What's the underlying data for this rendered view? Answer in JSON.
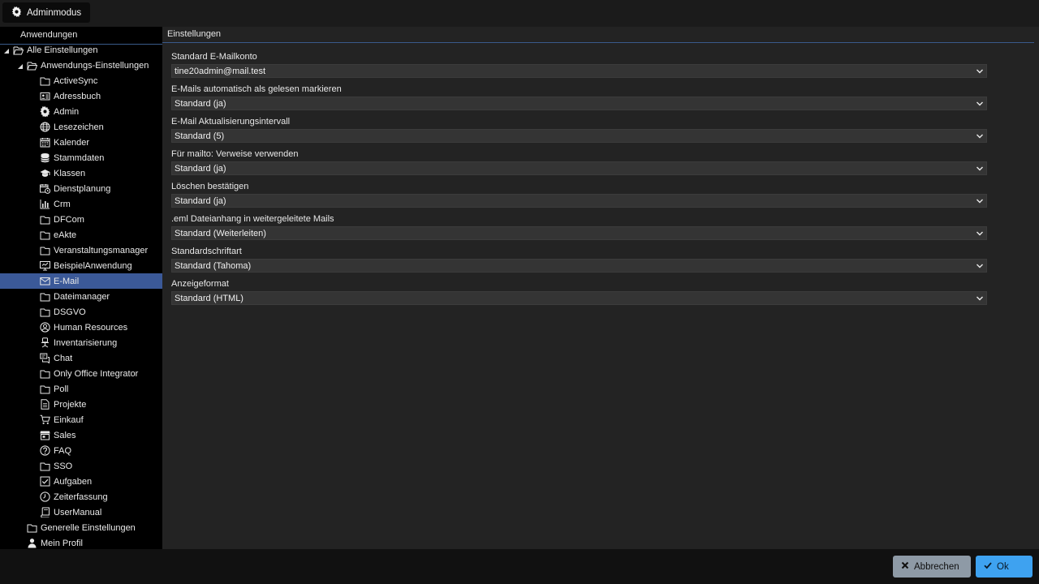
{
  "topbar": {
    "admin_label": "Adminmodus"
  },
  "sidebar": {
    "header": "Anwendungen",
    "tree": [
      {
        "label": "Alle Einstellungen",
        "icon": "folder-open-icon",
        "level": 0,
        "expanded": true
      },
      {
        "label": "Anwendungs-Einstellungen",
        "icon": "folder-open-icon",
        "level": 1,
        "expanded": true
      },
      {
        "label": "ActiveSync",
        "icon": "folder-icon",
        "level": 2
      },
      {
        "label": "Adressbuch",
        "icon": "address-card-icon",
        "level": 2
      },
      {
        "label": "Admin",
        "icon": "gear-icon",
        "level": 2
      },
      {
        "label": "Lesezeichen",
        "icon": "globe-icon",
        "level": 2
      },
      {
        "label": "Kalender",
        "icon": "calendar-icon",
        "level": 2
      },
      {
        "label": "Stammdaten",
        "icon": "database-icon",
        "level": 2
      },
      {
        "label": "Klassen",
        "icon": "graduation-cap-icon",
        "level": 2
      },
      {
        "label": "Dienstplanung",
        "icon": "calendar-clock-icon",
        "level": 2
      },
      {
        "label": "Crm",
        "icon": "bar-chart-icon",
        "level": 2
      },
      {
        "label": "DFCom",
        "icon": "folder-icon",
        "level": 2
      },
      {
        "label": "eAkte",
        "icon": "folder-icon",
        "level": 2
      },
      {
        "label": "Veranstaltungsmanager",
        "icon": "folder-icon",
        "level": 2
      },
      {
        "label": "BeispielAnwendung",
        "icon": "monitor-icon",
        "level": 2
      },
      {
        "label": "E-Mail",
        "icon": "envelope-icon",
        "level": 2,
        "selected": true
      },
      {
        "label": "Dateimanager",
        "icon": "folder-icon",
        "level": 2
      },
      {
        "label": "DSGVO",
        "icon": "folder-icon",
        "level": 2
      },
      {
        "label": "Human Resources",
        "icon": "user-circle-icon",
        "level": 2
      },
      {
        "label": "Inventarisierung",
        "icon": "chair-icon",
        "level": 2
      },
      {
        "label": "Chat",
        "icon": "chat-icon",
        "level": 2
      },
      {
        "label": "Only Office Integrator",
        "icon": "folder-icon",
        "level": 2
      },
      {
        "label": "Poll",
        "icon": "folder-icon",
        "level": 2
      },
      {
        "label": "Projekte",
        "icon": "document-icon",
        "level": 2
      },
      {
        "label": "Einkauf",
        "icon": "cart-icon",
        "level": 2
      },
      {
        "label": "Sales",
        "icon": "store-icon",
        "level": 2
      },
      {
        "label": "FAQ",
        "icon": "question-circle-icon",
        "level": 2
      },
      {
        "label": "SSO",
        "icon": "folder-icon",
        "level": 2
      },
      {
        "label": "Aufgaben",
        "icon": "checkbox-icon",
        "level": 2
      },
      {
        "label": "Zeiterfassung",
        "icon": "clock-icon",
        "level": 2
      },
      {
        "label": "UserManual",
        "icon": "book-icon",
        "level": 2
      },
      {
        "label": "Generelle Einstellungen",
        "icon": "folder-icon",
        "level": 1
      },
      {
        "label": "Mein Profil",
        "icon": "user-icon",
        "level": 1
      }
    ]
  },
  "main": {
    "header": "Einstellungen",
    "fields": [
      {
        "label": "Standard E-Mailkonto",
        "value": "tine20admin@mail.test"
      },
      {
        "label": "E-Mails automatisch als gelesen markieren",
        "value": "Standard (ja)"
      },
      {
        "label": "E-Mail Aktualisierungsintervall",
        "value": "Standard (5)"
      },
      {
        "label": "Für mailto: Verweise verwenden",
        "value": "Standard (ja)"
      },
      {
        "label": "Löschen bestätigen",
        "value": "Standard (ja)"
      },
      {
        "label": ".eml Dateianhang in weitergeleitete Mails",
        "value": "Standard (Weiterleiten)"
      },
      {
        "label": "Standardschriftart",
        "value": "Standard (Tahoma)"
      },
      {
        "label": "Anzeigeformat",
        "value": "Standard (HTML)"
      }
    ]
  },
  "footer": {
    "cancel_label": "Abbrechen",
    "ok_label": "Ok"
  },
  "colors": {
    "selected": "#3b5998",
    "ok_button": "#3ea2f0",
    "cancel_button": "#8e9aa6"
  }
}
